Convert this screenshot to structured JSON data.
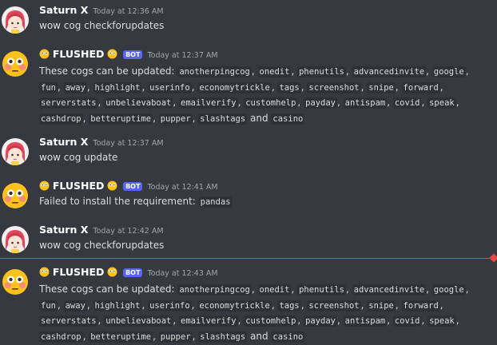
{
  "messages": [
    {
      "author": "Saturn X",
      "timestamp": "Today at 12:36 AM",
      "text": "wow cog checkforupdates"
    },
    {
      "author": "FLUSHED",
      "badge": "BOT",
      "timestamp": "Today at 12:37 AM",
      "prefix": "These cogs can be updated:",
      "cogs": [
        "anotherpingcog",
        "onedit",
        "phenutils",
        "advancedinvite",
        "google",
        "fun",
        "away",
        "highlight",
        "userinfo",
        "economytrickle",
        "tags",
        "screenshot",
        "snipe",
        "forward",
        "serverstats",
        "unbelievaboat",
        "emailverify",
        "customhelp",
        "payday",
        "antispam",
        "covid",
        "speak",
        "cashdrop",
        "betteruptime",
        "pupper",
        "slashtags",
        "casino"
      ]
    },
    {
      "author": "Saturn X",
      "timestamp": "Today at 12:37 AM",
      "text": "wow cog update"
    },
    {
      "author": "FLUSHED",
      "badge": "BOT",
      "timestamp": "Today at 12:41 AM",
      "prefix": "Failed to install the requirement:",
      "code": "pandas"
    },
    {
      "author": "Saturn X",
      "timestamp": "Today at 12:42 AM",
      "text": "wow cog checkforupdates"
    },
    {
      "author": "FLUSHED",
      "badge": "BOT",
      "timestamp": "Today at 12:43 AM",
      "prefix": "These cogs can be updated:",
      "cogs": [
        "anotherpingcog",
        "onedit",
        "phenutils",
        "advancedinvite",
        "google",
        "fun",
        "away",
        "highlight",
        "userinfo",
        "economytrickle",
        "tags",
        "screenshot",
        "snipe",
        "forward",
        "serverstats",
        "unbelievaboat",
        "emailverify",
        "customhelp",
        "payday",
        "antispam",
        "covid",
        "speak",
        "cashdrop",
        "betteruptime",
        "pupper",
        "slashtags",
        "casino"
      ]
    }
  ],
  "conjunction": "and",
  "colors": {
    "background": "#36393f",
    "bot_badge": "#5865f2",
    "new_divider": "#ed4245"
  }
}
